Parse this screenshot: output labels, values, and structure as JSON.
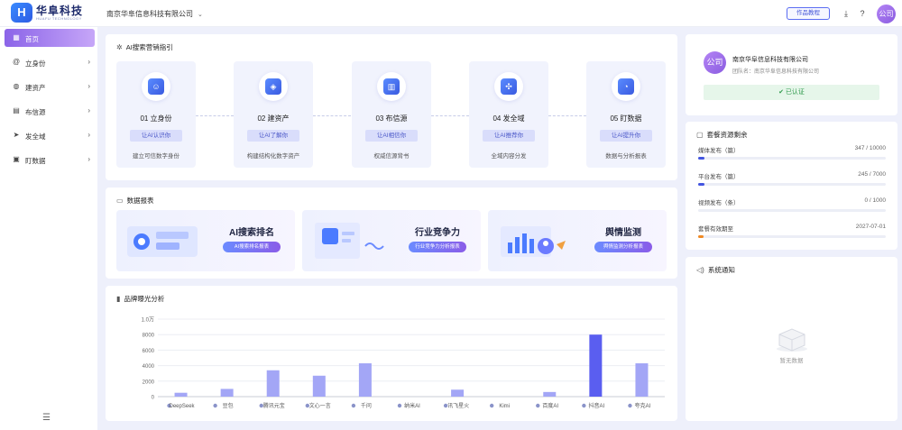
{
  "brand": {
    "name": "华阜科技",
    "subtitle": "HUAFU TECHNOLOGY",
    "logo_letter": "H"
  },
  "header": {
    "company": "南京华阜信息科技有限公司",
    "tutorial_label": "作品教程",
    "avatar_text": "公司",
    "icons": [
      "download-icon",
      "help-icon"
    ]
  },
  "sidebar": {
    "items": [
      {
        "label": "首页",
        "icon": "grid-icon",
        "active": true
      },
      {
        "label": "立身份",
        "icon": "at-icon"
      },
      {
        "label": "建资产",
        "icon": "signal-icon"
      },
      {
        "label": "布信源",
        "icon": "table-icon"
      },
      {
        "label": "发全域",
        "icon": "send-icon"
      },
      {
        "label": "盯数据",
        "icon": "monitor-icon"
      }
    ]
  },
  "guide": {
    "title": "AI搜索营销指引",
    "steps": [
      {
        "title": "01 立身份",
        "button": "让AI认识你",
        "desc": "建立可信数字身份"
      },
      {
        "title": "02 建资产",
        "button": "让AI了解你",
        "desc": "构建结构化数字资产"
      },
      {
        "title": "03 布信源",
        "button": "让AI相信你",
        "desc": "权威信源背书"
      },
      {
        "title": "04 发全域",
        "button": "让AI推荐你",
        "desc": "全域内容分发"
      },
      {
        "title": "05 盯数据",
        "button": "让AI提升你",
        "desc": "数据与分析报表"
      }
    ]
  },
  "reports": {
    "title": "数据报表",
    "items": [
      {
        "title": "AI搜索排名",
        "button": "AI搜索排名报表"
      },
      {
        "title": "行业竞争力",
        "button": "行业竞争力分析报表"
      },
      {
        "title": "舆情监测",
        "button": "舆情监测分析报表"
      }
    ]
  },
  "brand_exposure": {
    "title": "品牌曝光分析",
    "chart_data": {
      "type": "bar",
      "categories": [
        "DeepSeek",
        "豆包",
        "腾讯元宝",
        "文心一言",
        "千问",
        "纳米AI",
        "讯飞星火",
        "Kimi",
        "百度AI",
        "抖音AI",
        "夸克AI"
      ],
      "values": [
        500,
        1000,
        3400,
        2700,
        4300,
        0,
        900,
        0,
        600,
        8000,
        4300
      ],
      "highlight_index": 9,
      "yticks": [
        "0",
        "2000",
        "4000",
        "6000",
        "8000",
        "1.0万"
      ],
      "ylim": [
        0,
        10000
      ],
      "colors": {
        "bar": "#a3a6f6",
        "highlight": "#5a5ef0"
      }
    }
  },
  "profile": {
    "avatar_text": "公司",
    "company": "南京华阜信息科技有限公司",
    "team": "团队名：南京华阜信息科技有限公司",
    "cert_label": "已认证"
  },
  "quota": {
    "title": "套餐资源剩余",
    "rows": [
      {
        "label": "媒体发布（篇）",
        "value": "347 / 10000",
        "ratio": 0.035,
        "color": "#4355e0"
      },
      {
        "label": "平台发布（篇）",
        "value": "245 / 7000",
        "ratio": 0.035,
        "color": "#4355e0"
      },
      {
        "label": "视频发布（条）",
        "value": "0 / 1000",
        "ratio": 0.0,
        "color": "#4355e0"
      },
      {
        "label": "套餐有效期至",
        "value": "2027-07-01",
        "ratio": 0.03,
        "color": "#f08a24"
      }
    ]
  },
  "notice": {
    "title": "系统通知",
    "empty_text": "暂无数据"
  }
}
